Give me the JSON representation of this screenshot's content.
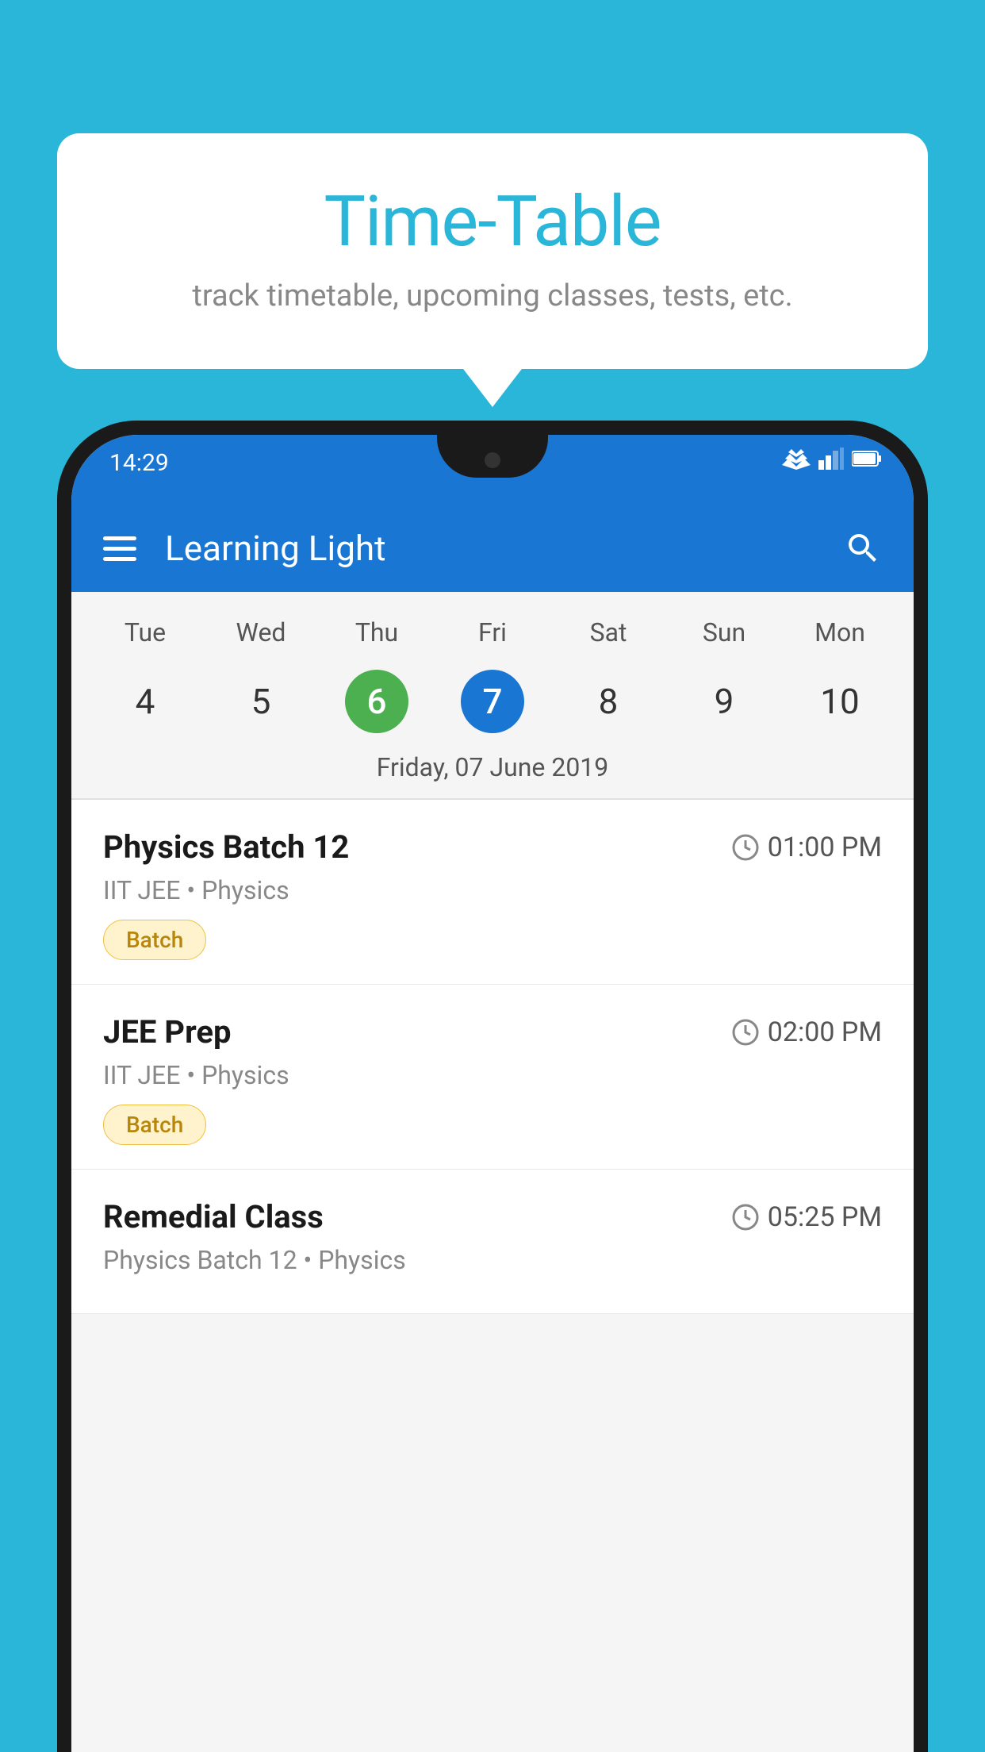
{
  "background_color": "#29b6d8",
  "tooltip": {
    "title": "Time-Table",
    "subtitle": "track timetable, upcoming classes, tests, etc."
  },
  "phone": {
    "status_bar": {
      "time": "14:29"
    },
    "app_bar": {
      "title": "Learning Light"
    },
    "calendar": {
      "days": [
        {
          "name": "Tue",
          "num": "4",
          "state": "normal"
        },
        {
          "name": "Wed",
          "num": "5",
          "state": "normal"
        },
        {
          "name": "Thu",
          "num": "6",
          "state": "today"
        },
        {
          "name": "Fri",
          "num": "7",
          "state": "selected"
        },
        {
          "name": "Sat",
          "num": "8",
          "state": "normal"
        },
        {
          "name": "Sun",
          "num": "9",
          "state": "normal"
        },
        {
          "name": "Mon",
          "num": "10",
          "state": "normal"
        }
      ],
      "selected_date_label": "Friday, 07 June 2019"
    },
    "schedule": [
      {
        "title": "Physics Batch 12",
        "time": "01:00 PM",
        "subtitle": "IIT JEE • Physics",
        "badge": "Batch"
      },
      {
        "title": "JEE Prep",
        "time": "02:00 PM",
        "subtitle": "IIT JEE • Physics",
        "badge": "Batch"
      },
      {
        "title": "Remedial Class",
        "time": "05:25 PM",
        "subtitle": "Physics Batch 12 • Physics",
        "badge": null
      }
    ]
  }
}
